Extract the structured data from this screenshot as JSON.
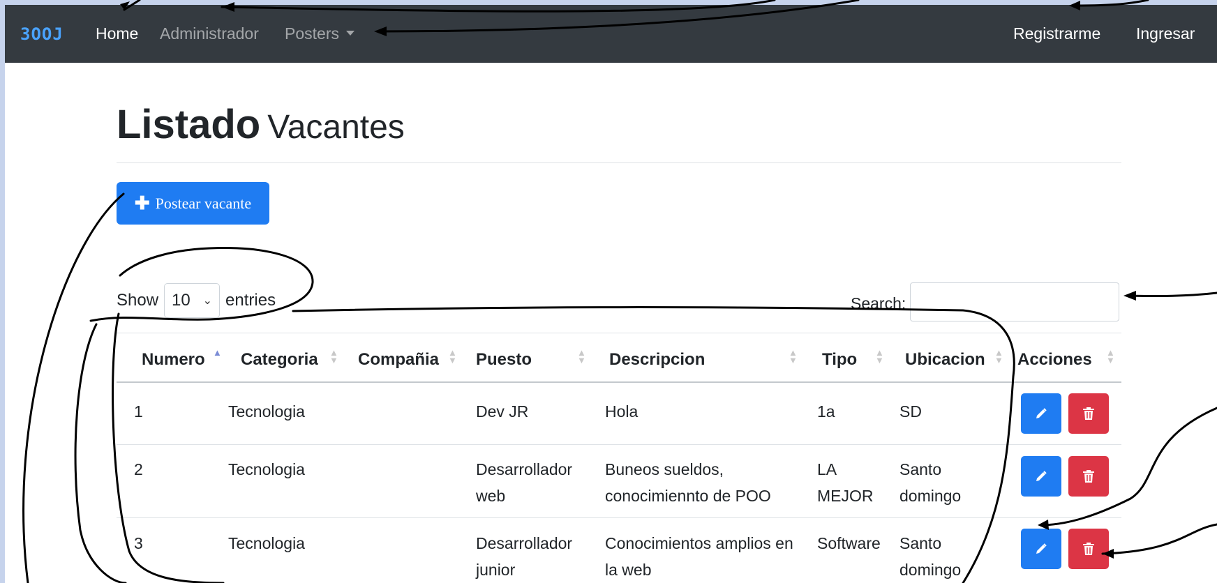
{
  "navbar": {
    "brand": "3OOJ",
    "links": [
      "Home",
      "Administrador",
      "Posters"
    ],
    "right_links": [
      "Registrarme",
      "Ingresar"
    ]
  },
  "page": {
    "title_bold": "Listado",
    "title_light": "Vacantes",
    "post_button": "Postear vacante"
  },
  "table_controls": {
    "show_label": "Show",
    "entries_value": "10",
    "entries_label": "entries",
    "search_label": "Search:"
  },
  "table": {
    "headers": [
      "Numero",
      "Categoria",
      "Compañia",
      "Puesto",
      "Descripcion",
      "Tipo",
      "Ubicacion",
      "Acciones"
    ],
    "rows": [
      {
        "numero": "1",
        "categoria": "Tecnologia",
        "compania": "",
        "puesto": "Dev JR",
        "descripcion": "Hola",
        "tipo": "1a",
        "ubicacion": "SD"
      },
      {
        "numero": "2",
        "categoria": "Tecnologia",
        "compania": "",
        "puesto": "Desarrollador web",
        "descripcion": "Buneos sueldos, conocimiennto de POO",
        "tipo": "LA MEJOR",
        "ubicacion": "Santo domingo"
      },
      {
        "numero": "3",
        "categoria": "Tecnologia",
        "compania": "",
        "puesto": "Desarrollador junior",
        "descripcion": "Conocimientos amplios en la web",
        "tipo": "Software",
        "ubicacion": "Santo domingo"
      }
    ]
  },
  "colors": {
    "navbar": "#343a40",
    "primary": "#1f7cf2",
    "danger": "#dc3545",
    "background": "#c6d3ec",
    "annotation_ink": "#000000"
  },
  "icons": [
    "plus-icon",
    "chevron-down-icon",
    "sort-icon",
    "pencil-icon",
    "trash-icon"
  ]
}
